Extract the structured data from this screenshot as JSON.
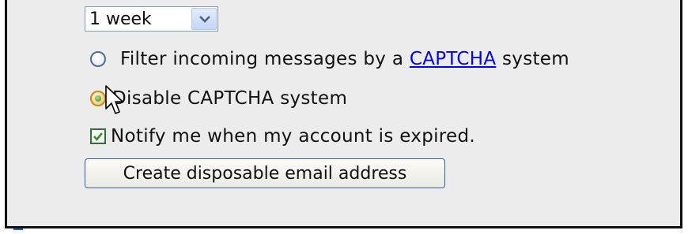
{
  "expiry_select": {
    "value": "1 week"
  },
  "options": {
    "captcha_filter": {
      "label_before": "Filter incoming messages by a ",
      "link": "CAPTCHA",
      "label_after": " system",
      "checked": false
    },
    "captcha_disable": {
      "label": "Disable CAPTCHA system",
      "checked": true
    },
    "notify_expired": {
      "label": "Notify me when my account is expired.",
      "checked": true
    }
  },
  "create_button": {
    "label": "Create disposable email address"
  }
}
